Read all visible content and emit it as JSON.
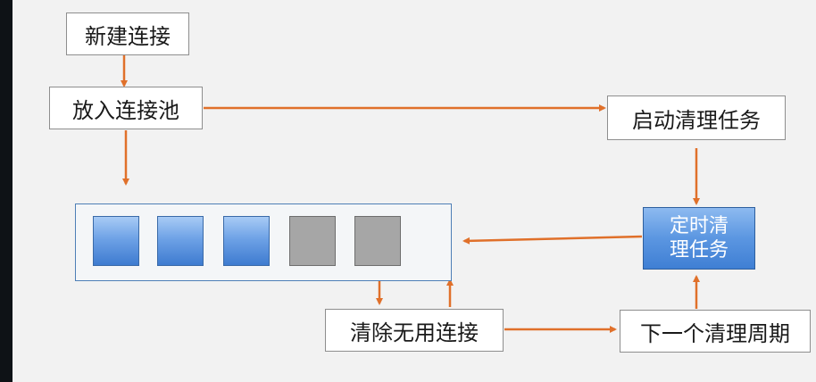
{
  "nodes": {
    "new_connection": "新建连接",
    "put_in_pool": "放入连接池",
    "start_cleanup_task": "启动清理任务",
    "scheduled_cleanup_line1": "定时清",
    "scheduled_cleanup_line2": "理任务",
    "clear_unused": "清除无用连接",
    "next_cycle": "下一个清理周期"
  },
  "pool": {
    "slots": [
      "active",
      "active",
      "active",
      "idle",
      "idle"
    ]
  },
  "colors": {
    "arrow": "#e0702a",
    "pool_border": "#4e7fb6",
    "active_slot": "#5b96e1",
    "idle_slot": "#a6a6a6",
    "timer_fill": "#5b96e1"
  }
}
